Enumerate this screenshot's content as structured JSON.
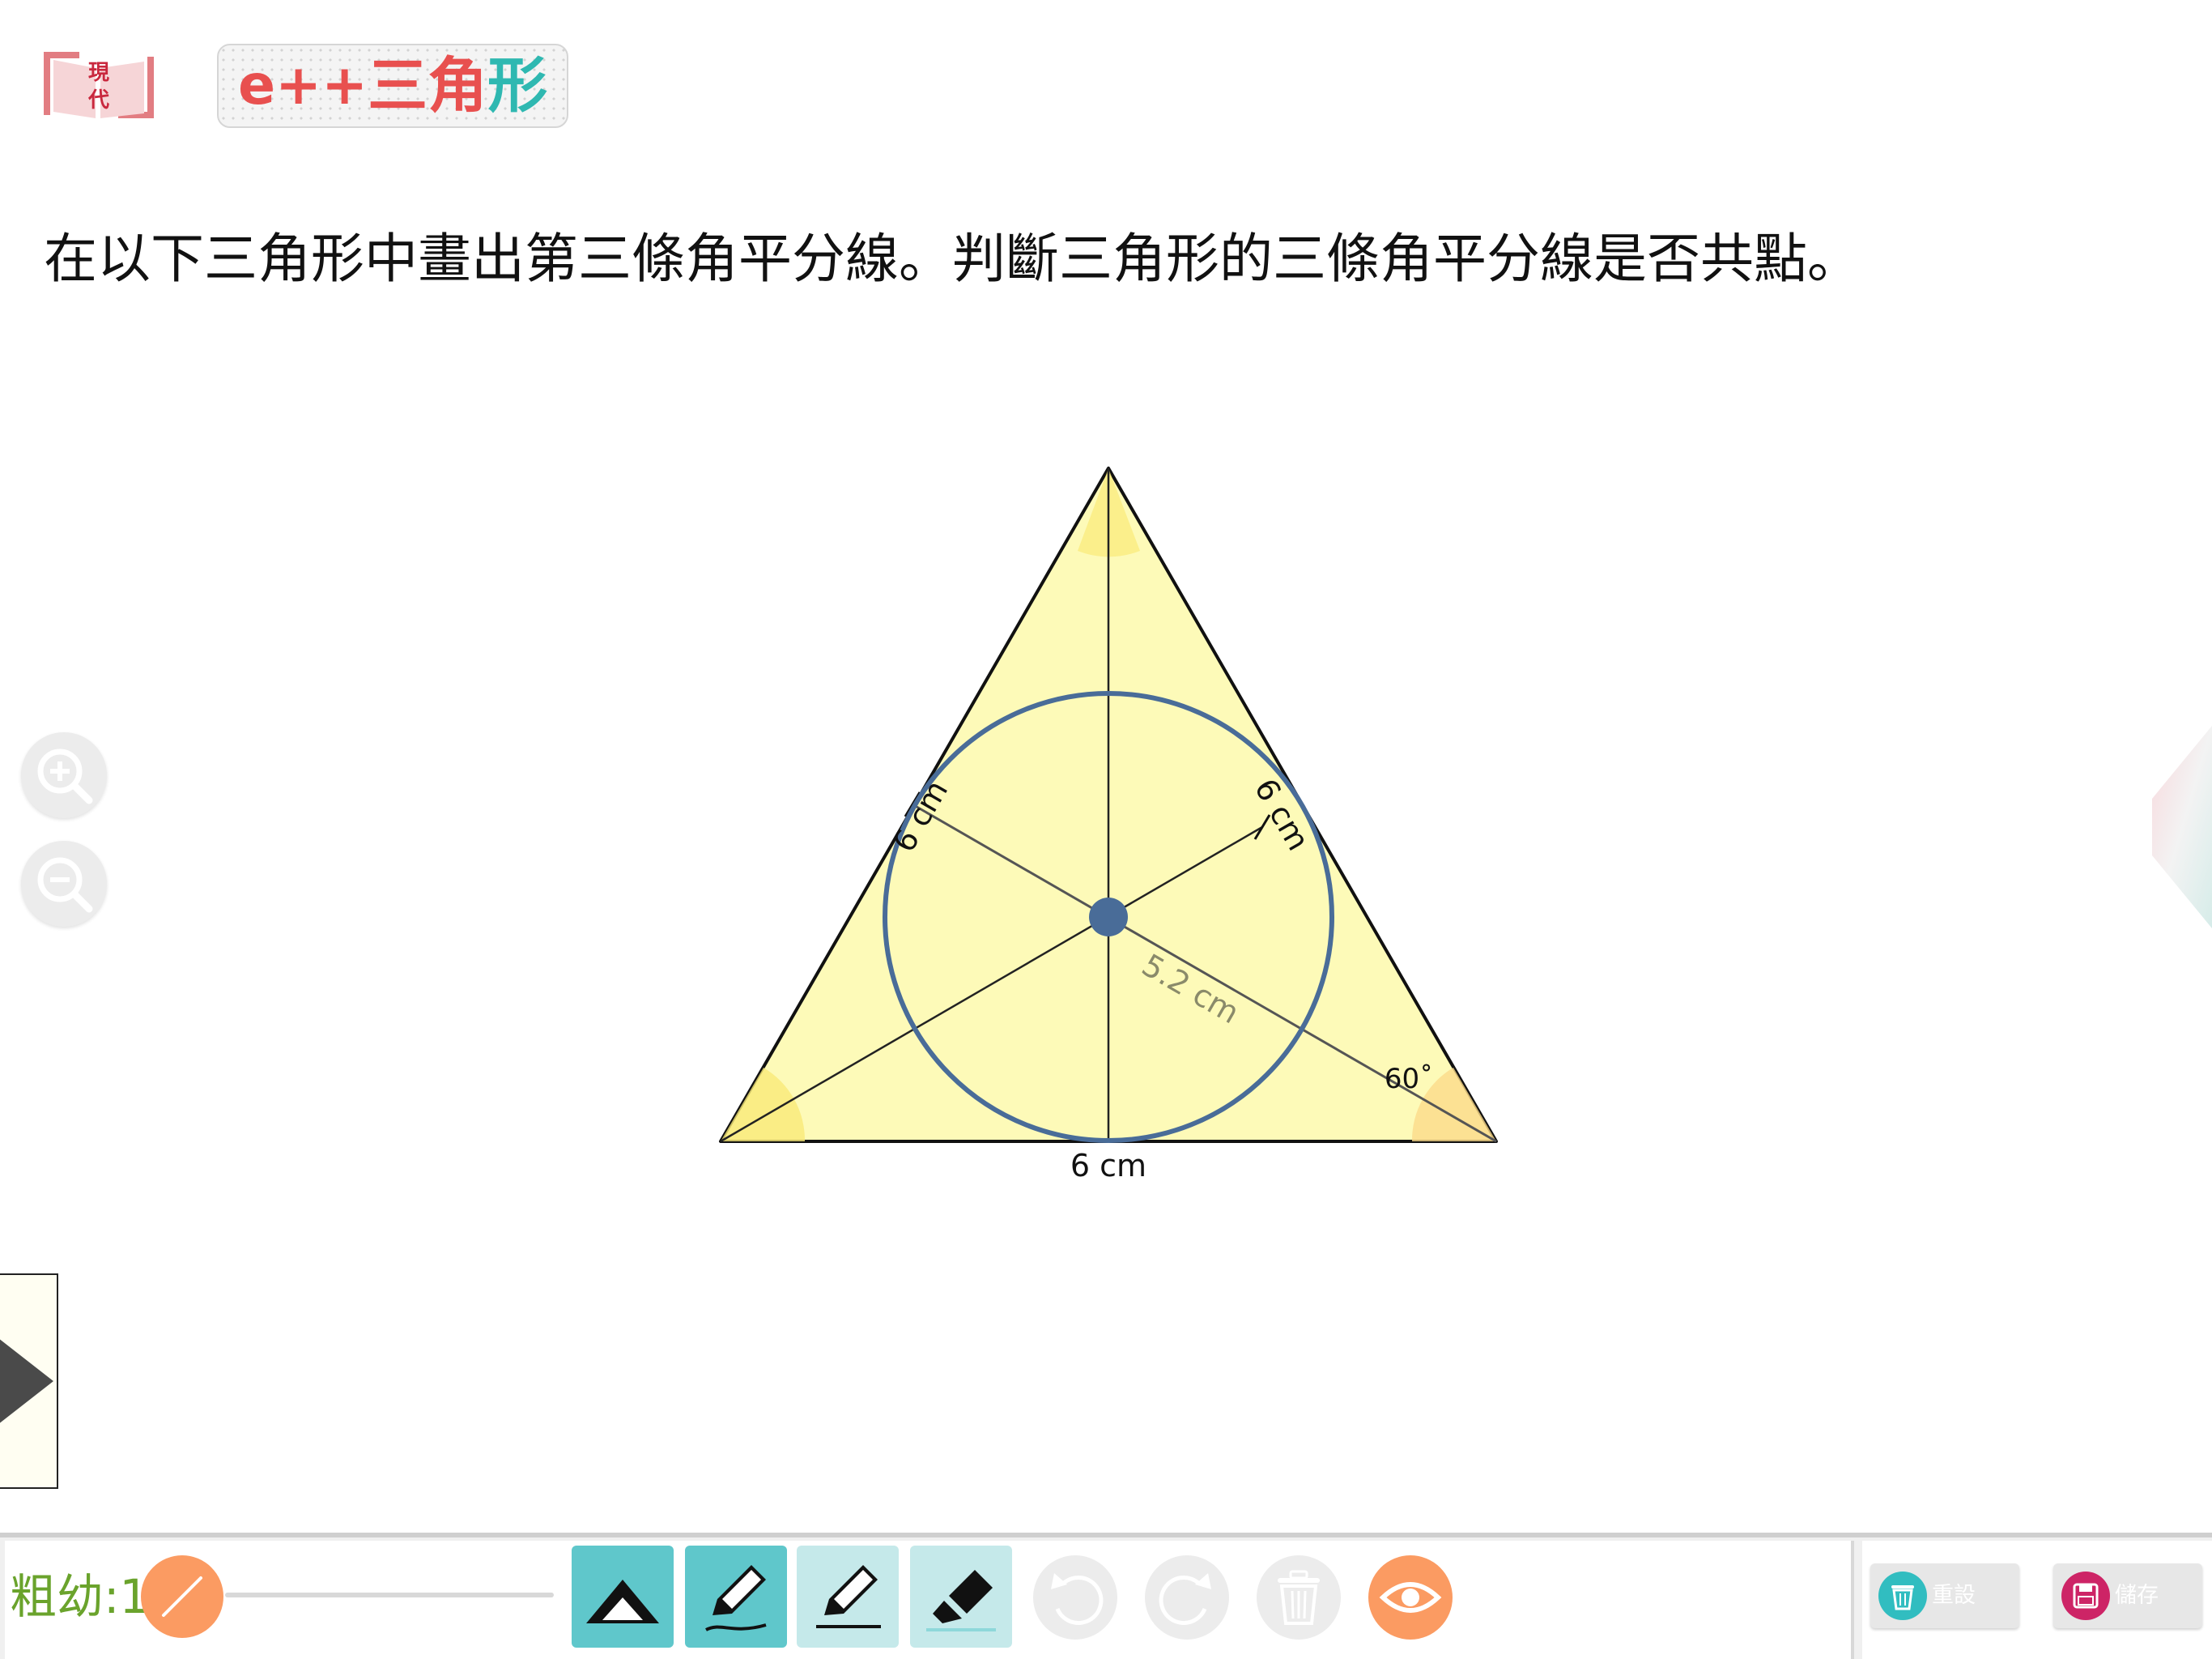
{
  "header": {
    "logo_text": "現代",
    "title_prefix": "e++",
    "title_chars": [
      "三",
      "角",
      "形"
    ]
  },
  "question": {
    "text": "在以下三角形中畫出第三條角平分線。判斷三角形的三條角平分線是否共點。"
  },
  "diagram": {
    "labels": {
      "left_side": "6 cm",
      "right_side": "6 cm",
      "base": "6 cm",
      "bisector_length": "5.2 cm",
      "base_right_angle": "60˚"
    },
    "colors": {
      "triangle_fill": "#fdfab8",
      "angle_marker": "#f9ea78",
      "incircle": "#496c98",
      "incenter": "#496c98"
    }
  },
  "zoom": {
    "in_icon": "zoom-in-icon",
    "out_icon": "zoom-out-icon"
  },
  "toolbar": {
    "thickness_label": "粗幼:1",
    "tools": [
      "shape-tool",
      "pen-tool",
      "pencil-tool",
      "marker-tool"
    ],
    "reset_label": "重設",
    "save_label": "儲存",
    "colors": {
      "accent_orange": "#fb9b62",
      "tool_active": "#5fc7cb",
      "tool_inactive": "#c5e9ea",
      "thickness_text": "#6aa32c",
      "reset_icon": "#31bdc0",
      "save_icon": "#cd2466"
    }
  }
}
